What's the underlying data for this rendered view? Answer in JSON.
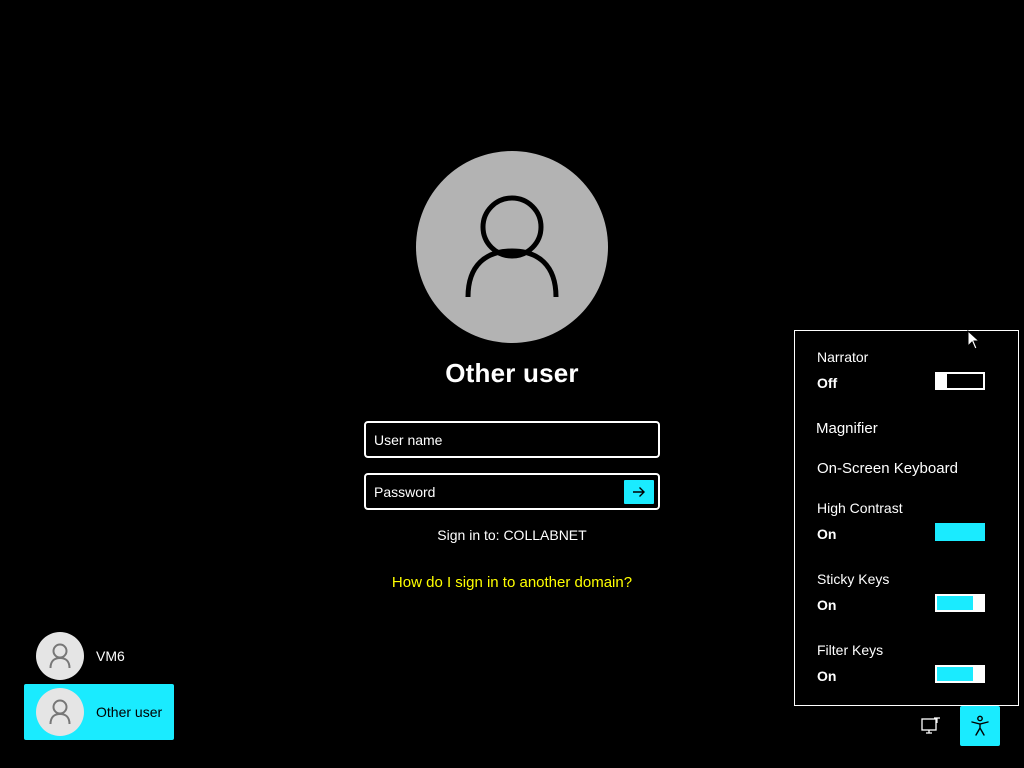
{
  "login": {
    "display_name": "Other user",
    "username_placeholder": "User name",
    "password_placeholder": "Password",
    "sign_in_to": "Sign in to: COLLABNET",
    "domain_help_link": "How do I sign in to another domain?"
  },
  "user_list": [
    {
      "label": "VM6",
      "selected": false
    },
    {
      "label": "Other user",
      "selected": true
    }
  ],
  "accessibility_panel": {
    "narrator": {
      "label": "Narrator",
      "state": "Off"
    },
    "magnifier": {
      "label": "Magnifier"
    },
    "onscreen_keyboard": {
      "label": "On-Screen Keyboard"
    },
    "high_contrast": {
      "label": "High Contrast",
      "state": "On"
    },
    "sticky_keys": {
      "label": "Sticky Keys",
      "state": "On"
    },
    "filter_keys": {
      "label": "Filter Keys",
      "state": "On"
    }
  },
  "bottom_icons": [
    "network-icon",
    "accessibility-icon"
  ],
  "colors": {
    "accent": "#1aebff",
    "link": "#ffff00",
    "background": "#000000",
    "avatar": "#b3b3b3"
  }
}
